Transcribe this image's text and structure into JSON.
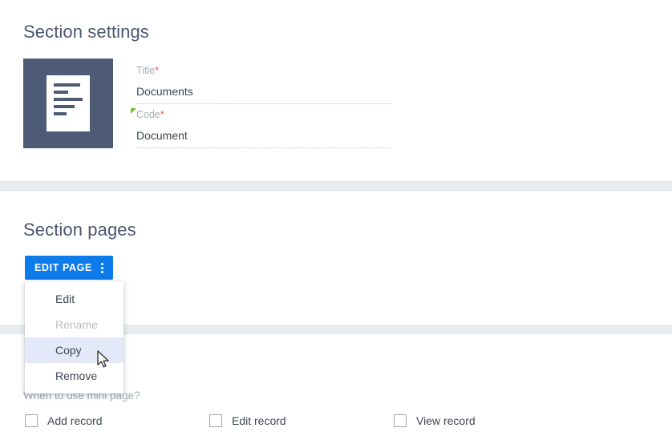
{
  "sections": {
    "settings": {
      "title": "Section settings",
      "icon_name": "document-lines-icon",
      "fields": [
        {
          "label": "Title",
          "required_mark": "*",
          "value": "Documents",
          "placeholder": "",
          "has_green_flag": false
        },
        {
          "label": "Code",
          "required_mark": "*",
          "value": "Document",
          "placeholder": "",
          "has_green_flag": true
        }
      ]
    },
    "pages": {
      "title": "Section pages",
      "edit_page_button": {
        "label": "EDIT PAGE",
        "menu_icon": "kebab-vertical-icon"
      },
      "dropdown": {
        "items": [
          {
            "label": "Edit",
            "state": "enabled"
          },
          {
            "label": "Rename",
            "state": "disabled"
          },
          {
            "label": "Copy",
            "state": "highlighted"
          },
          {
            "label": "Remove",
            "state": "enabled"
          }
        ]
      }
    },
    "mini_page": {
      "question_label": "When to use mini page?",
      "checkboxes": [
        {
          "label": "Add record",
          "checked": false
        },
        {
          "label": "Edit record",
          "checked": false
        },
        {
          "label": "View record",
          "checked": false
        }
      ]
    }
  },
  "colors": {
    "accent_blue": "#0d7bea",
    "icon_tile": "#4e5b77",
    "heading": "#4a5670",
    "label_muted": "#a6acb8",
    "required_star": "#f4624a",
    "green_flag": "#72c02c",
    "menu_highlight": "#e3e9f8",
    "separator_band": "#eaedef"
  }
}
